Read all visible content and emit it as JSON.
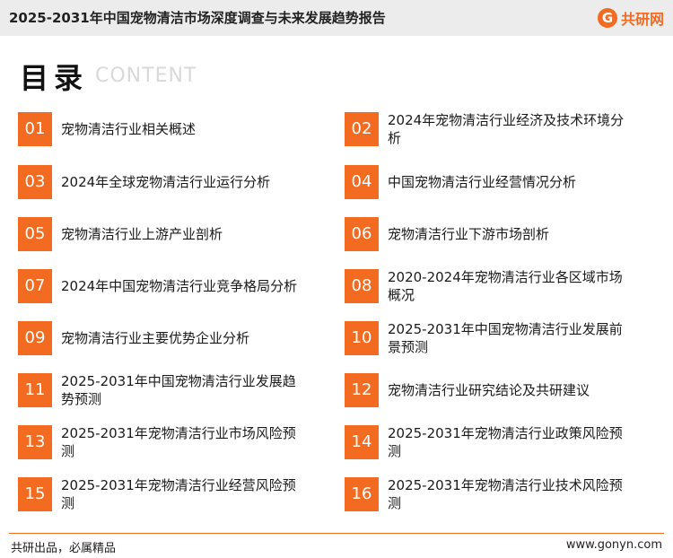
{
  "header": {
    "title": "2025-2031年中国宠物清洁市场深度调查与未来发展趋势报告",
    "logo_mark": "G",
    "logo_text": "共研网"
  },
  "toc": {
    "title": "目录",
    "subtitle": "CONTENT"
  },
  "items": [
    {
      "num": "01",
      "label": "宠物清洁行业相关概述"
    },
    {
      "num": "02",
      "label": "2024年宠物清洁行业经济及技术环境分析"
    },
    {
      "num": "03",
      "label": "2024年全球宠物清洁行业运行分析"
    },
    {
      "num": "04",
      "label": "中国宠物清洁行业经营情况分析"
    },
    {
      "num": "05",
      "label": "宠物清洁行业上游产业剖析"
    },
    {
      "num": "06",
      "label": "宠物清洁行业下游市场剖析"
    },
    {
      "num": "07",
      "label": "2024年中国宠物清洁行业竞争格局分析"
    },
    {
      "num": "08",
      "label": "2020-2024年宠物清洁行业各区域市场概况"
    },
    {
      "num": "09",
      "label": "宠物清洁行业主要优势企业分析"
    },
    {
      "num": "10",
      "label": "2025-2031年中国宠物清洁行业发展前景预测"
    },
    {
      "num": "11",
      "label": "2025-2031年中国宠物清洁行业发展趋势预测"
    },
    {
      "num": "12",
      "label": "宠物清洁行业研究结论及共研建议"
    },
    {
      "num": "13",
      "label": "2025-2031年宠物清洁行业市场风险预测"
    },
    {
      "num": "14",
      "label": "2025-2031年宠物清洁行业政策风险预测"
    },
    {
      "num": "15",
      "label": "2025-2031年宠物清洁行业经营风险预测"
    },
    {
      "num": "16",
      "label": "2025-2031年宠物清洁行业技术风险预测"
    }
  ],
  "footer": {
    "slogan": "共研出品，必属精品",
    "url": "www.gonyn.com"
  },
  "colors": {
    "accent": "#f26b21",
    "header_bg": "#ececec"
  }
}
